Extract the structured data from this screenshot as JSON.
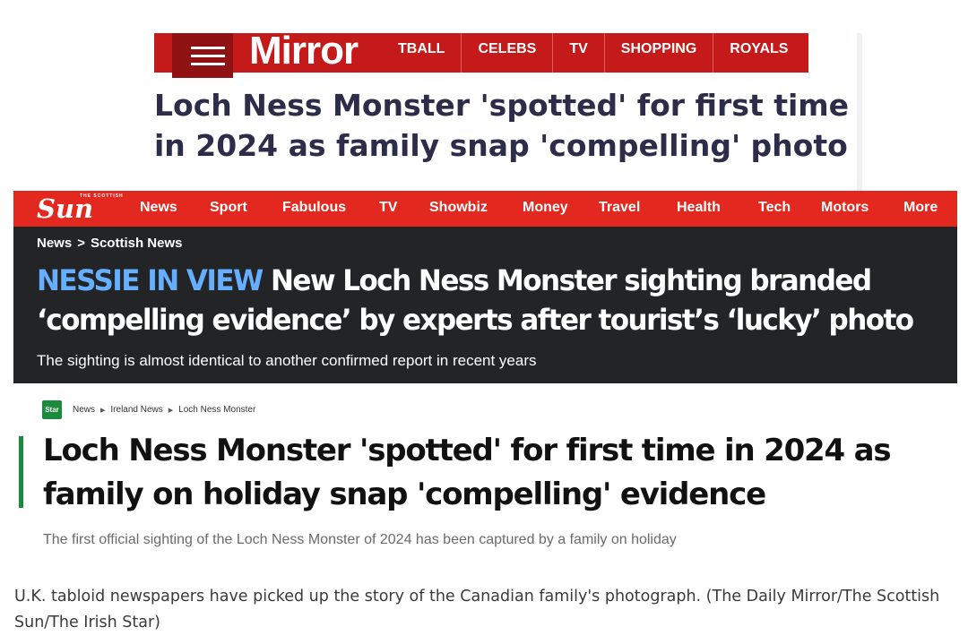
{
  "mirror": {
    "logo": "Mirror",
    "nav_items": [
      "TBALL",
      "CELEBS",
      "TV",
      "SHOPPING",
      "ROYALS"
    ],
    "headline": "Loch Ness Monster 'spotted' for first time in 2024 as family snap 'compelling' photo",
    "colors": {
      "nav": "#c51a1a",
      "headline": "#2d2d4a"
    }
  },
  "sun": {
    "logo": "Sun",
    "logo_small": "THE SCOTTISH",
    "nav_items": [
      "News",
      "Sport",
      "Fabulous",
      "TV",
      "Showbiz",
      "Money",
      "Travel",
      "Health",
      "Tech",
      "Motors",
      "More"
    ],
    "breadcrumb": [
      "News",
      "Scottish News"
    ],
    "breadcrumb_separator": ">",
    "kicker": "NESSIE IN VIEW",
    "headline": "New Loch Ness Monster sighting branded ‘compelling evidence’ by experts after tourist’s ‘lucky’ photo",
    "subhead": "The sighting is almost identical to another confirmed report in recent years",
    "colors": {
      "nav": "#e3281f",
      "background": "#222426",
      "kicker": "#66aeff"
    }
  },
  "star": {
    "logo": "Star",
    "breadcrumb": [
      "News",
      "Ireland News",
      "Loch Ness Monster"
    ],
    "headline": "Loch Ness Monster 'spotted' for first time in 2024 as family on holiday snap 'compelling' evidence",
    "subhead": "The first official sighting of the Loch Ness Monster of 2024 has been captured by a family on holiday",
    "colors": {
      "accent": "#1b8a3c"
    }
  },
  "caption": "U.K. tabloid newspapers have picked up the story of the Canadian family's photograph. (The Daily Mirror/The Scottish Sun/The Irish Star)"
}
